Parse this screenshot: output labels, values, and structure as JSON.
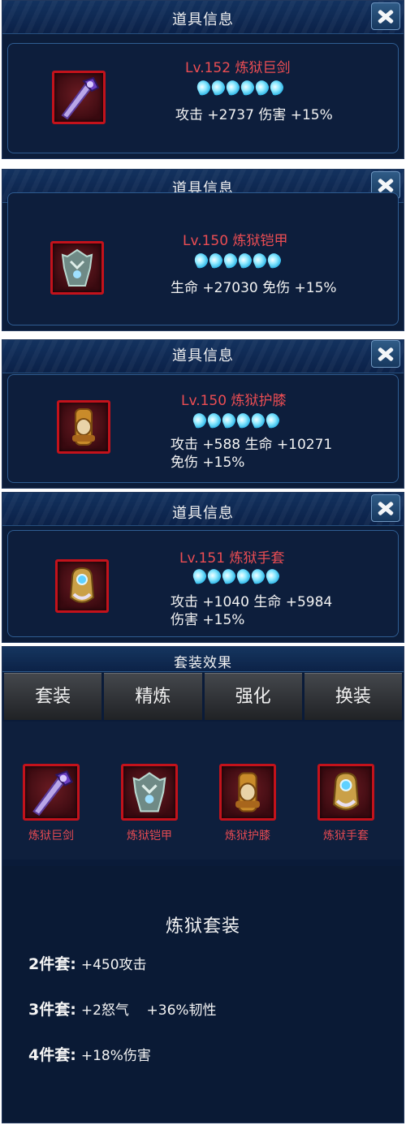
{
  "panels": [
    {
      "header": "道具信息",
      "name": "Lv.152 炼狱巨剑",
      "icon": "sword-icon",
      "stars": 6,
      "stat_lines": [
        "攻击 +2737  伤害 +15%"
      ]
    },
    {
      "header": "道具信息",
      "name": "Lv.150 炼狱铠甲",
      "icon": "armor-icon",
      "stars": 6,
      "stat_lines": [
        "生命 +27030  免伤 +15%"
      ]
    },
    {
      "header": "道具信息",
      "name": "Lv.150 炼狱护膝",
      "icon": "kneepad-icon",
      "stars": 6,
      "stat_lines": [
        "攻击 +588  生命 +10271",
        "免伤 +15%"
      ]
    },
    {
      "header": "道具信息",
      "name": "Lv.151 炼狱手套",
      "icon": "gauntlet-icon",
      "stars": 6,
      "stat_lines": [
        "攻击 +1040  生命 +5984",
        "伤害 +15%"
      ]
    }
  ],
  "set_panel": {
    "header": "套装效果",
    "tabs": [
      "套装",
      "精炼",
      "强化",
      "换装"
    ],
    "items": [
      {
        "label": "炼狱巨剑",
        "icon": "sword-icon"
      },
      {
        "label": "炼狱铠甲",
        "icon": "armor-icon"
      },
      {
        "label": "炼狱护膝",
        "icon": "kneepad-icon"
      },
      {
        "label": "炼狱手套",
        "icon": "gauntlet-icon"
      }
    ],
    "set_name": "炼狱套装",
    "bonuses": [
      {
        "pieces": "2件套:",
        "effect": "+450攻击"
      },
      {
        "pieces": "3件套:",
        "effect": "+2怒气    +36%韧性"
      },
      {
        "pieces": "4件套:",
        "effect": "+18%伤害"
      }
    ]
  },
  "colors": {
    "item_name": "#ec4d53",
    "icon_border": "#c3121b",
    "star": "#8fe9ff",
    "panel_bg": "#0c1d3a"
  }
}
